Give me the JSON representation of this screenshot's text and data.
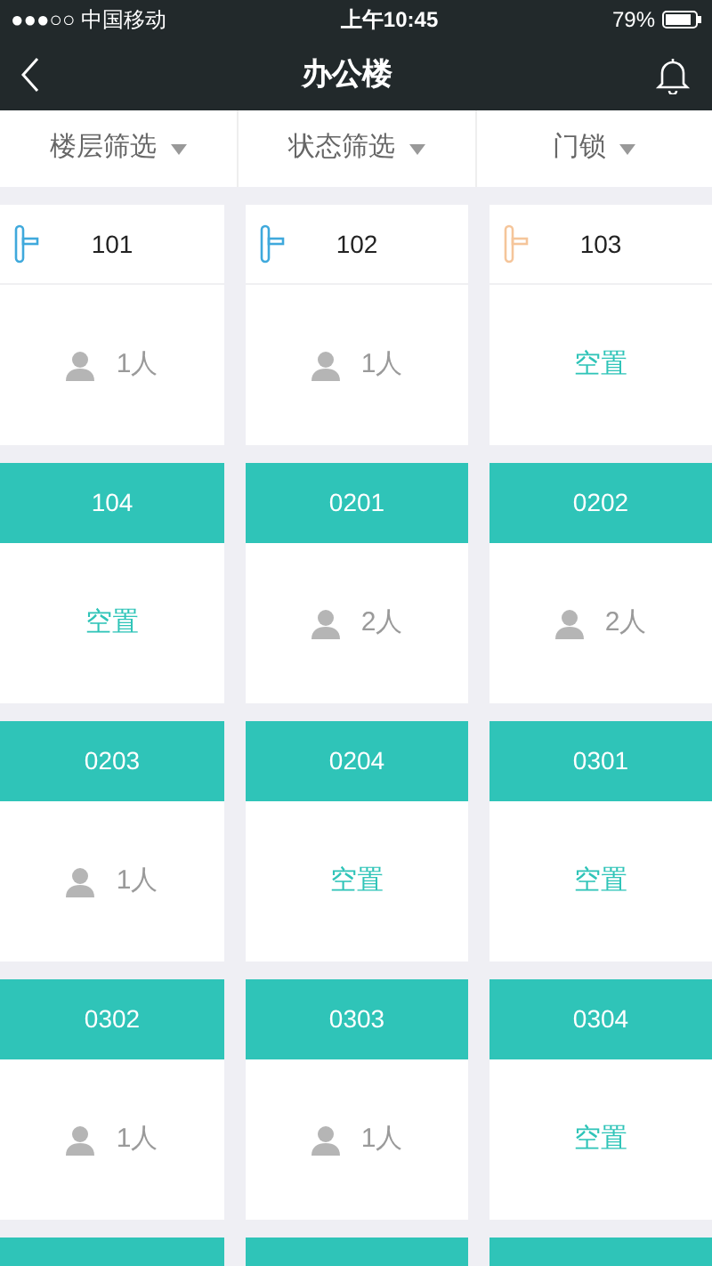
{
  "status_bar": {
    "carrier": "●●●○○ 中国移动",
    "time": "上午10:45",
    "battery": "79%"
  },
  "nav": {
    "title": "办公楼"
  },
  "filters": [
    {
      "label": "楼层筛选"
    },
    {
      "label": "状态筛选"
    },
    {
      "label": "门锁"
    }
  ],
  "rooms": [
    {
      "kind": "lock",
      "color": "#3fa9dc",
      "number": "101",
      "vacant": false,
      "occupancy": "1人"
    },
    {
      "kind": "lock",
      "color": "#3fa9dc",
      "number": "102",
      "vacant": false,
      "occupancy": "1人"
    },
    {
      "kind": "lock",
      "color": "#f5c59a",
      "number": "103",
      "vacant": true,
      "occupancy": "空置"
    },
    {
      "kind": "teal",
      "number": "104",
      "vacant": true,
      "occupancy": "空置"
    },
    {
      "kind": "teal",
      "number": "0201",
      "vacant": false,
      "occupancy": "2人"
    },
    {
      "kind": "teal",
      "number": "0202",
      "vacant": false,
      "occupancy": "2人"
    },
    {
      "kind": "teal",
      "number": "0203",
      "vacant": false,
      "occupancy": "1人"
    },
    {
      "kind": "teal",
      "number": "0204",
      "vacant": true,
      "occupancy": "空置"
    },
    {
      "kind": "teal",
      "number": "0301",
      "vacant": true,
      "occupancy": "空置"
    },
    {
      "kind": "teal",
      "number": "0302",
      "vacant": false,
      "occupancy": "1人"
    },
    {
      "kind": "teal",
      "number": "0303",
      "vacant": false,
      "occupancy": "1人"
    },
    {
      "kind": "teal",
      "number": "0304",
      "vacant": true,
      "occupancy": "空置"
    },
    {
      "kind": "teal"
    },
    {
      "kind": "teal"
    },
    {
      "kind": "teal"
    }
  ]
}
